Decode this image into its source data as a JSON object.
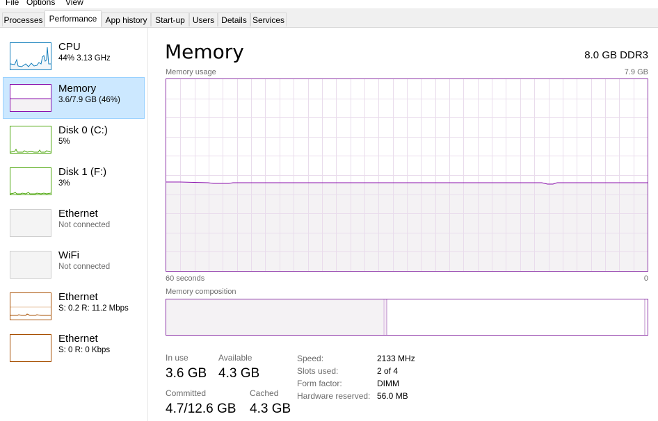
{
  "menu": [
    "File",
    "Options",
    "View"
  ],
  "tabs": [
    "Processes",
    "Performance",
    "App history",
    "Start-up",
    "Users",
    "Details",
    "Services"
  ],
  "active_tab": "Performance",
  "sidebar": [
    {
      "name": "CPU",
      "sub": "44%  3.13 GHz",
      "color": "#117dbb"
    },
    {
      "name": "Memory",
      "sub": "3.6/7.9 GB (46%)",
      "color": "#8b12ae"
    },
    {
      "name": "Disk 0 (C:)",
      "sub": "5%",
      "color": "#4da60c"
    },
    {
      "name": "Disk 1 (F:)",
      "sub": "3%",
      "color": "#4da60c"
    },
    {
      "name": "Ethernet",
      "sub": "Not connected",
      "color": "#cfcfcf"
    },
    {
      "name": "WiFi",
      "sub": "Not connected",
      "color": "#cfcfcf"
    },
    {
      "name": "Ethernet",
      "sub": "S: 0.2  R: 11.2 Mbps",
      "color": "#a74f01"
    },
    {
      "name": "Ethernet",
      "sub": "S: 0  R: 0 Kbps",
      "color": "#a74f01"
    }
  ],
  "main": {
    "title": "Memory",
    "spec": "8.0 GB DDR3",
    "usage_label": "Memory usage",
    "usage_max": "7.9 GB",
    "time_left": "60 seconds",
    "time_right": "0",
    "composition_label": "Memory composition",
    "usage_fraction": 0.46
  },
  "stats": {
    "in_use_label": "In use",
    "in_use": "3.6 GB",
    "available_label": "Available",
    "available": "4.3 GB",
    "committed_label": "Committed",
    "committed": "4.7/12.6 GB",
    "cached_label": "Cached",
    "cached": "4.3 GB"
  },
  "specs": [
    {
      "label": "Speed:",
      "value": "2133 MHz"
    },
    {
      "label": "Slots used:",
      "value": "2 of 4"
    },
    {
      "label": "Form factor:",
      "value": "DIMM"
    },
    {
      "label": "Hardware reserved:",
      "value": "56.0 MB"
    }
  ],
  "accent": "#8b12ae"
}
